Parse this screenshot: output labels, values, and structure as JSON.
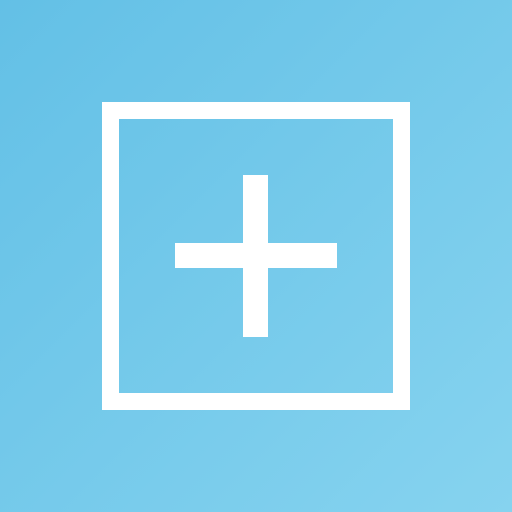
{
  "background": {
    "gradient_start": "#63c0e6",
    "gradient_end": "#86d3ef"
  },
  "add_button": {
    "icon": "plus-icon",
    "frame_color": "#ffffff",
    "icon_color": "#ffffff"
  }
}
